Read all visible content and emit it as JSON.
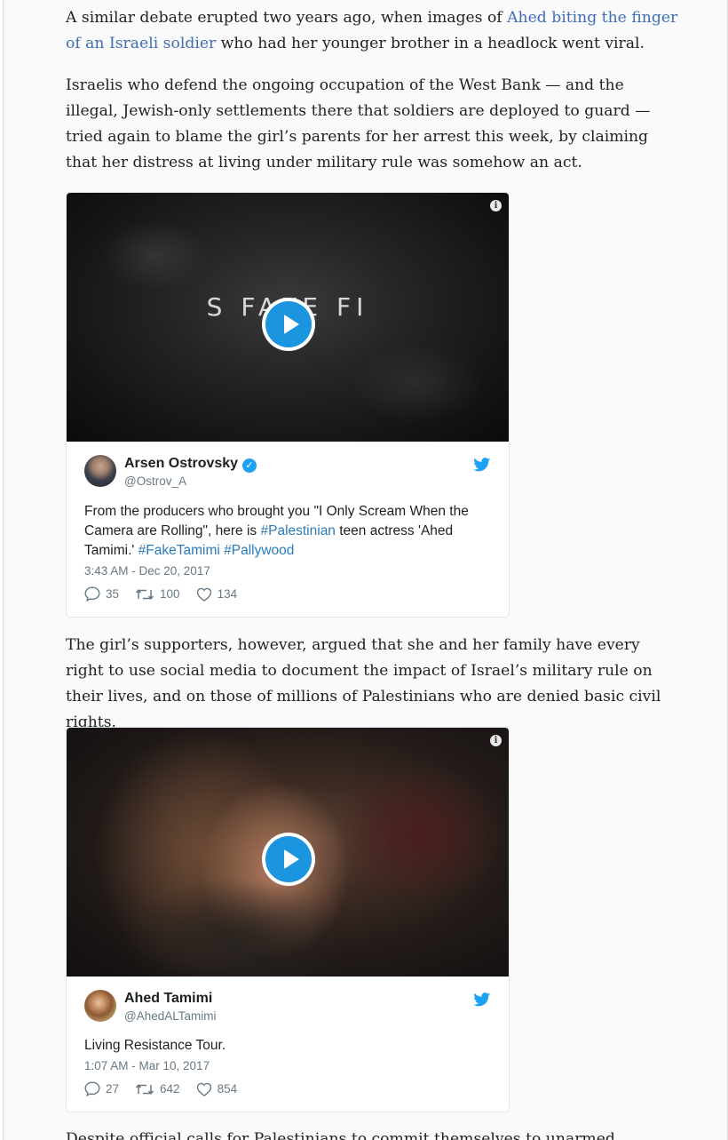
{
  "article": {
    "p1": {
      "before": "A similar debate erupted two years ago, when images of ",
      "link": "Ahed biting the finger of an Israeli soldier",
      "after": " who had her younger brother in a headlock went viral."
    },
    "p2": "Israelis who defend the ongoing occupation of the West Bank — and the illegal, Jewish-only settlements there that soldiers are deployed to guard — tried again to blame the girl’s parents for her arrest this week, by claiming that her distress at living under military rule was somehow an act.",
    "p3": "The girl’s supporters, however, argued that she and her family have every right to use social media to document the impact of Israel’s military rule on their lives, and on those of millions of Palestinians who are denied basic civil rights.",
    "p4": "Despite official calls for Palestinians to commit themselves to unarmed struggle"
  },
  "tweet1": {
    "video_overlay": "S FAKE FI",
    "name": "Arsen Ostrovsky",
    "verified_mark": "✓",
    "handle": "@Ostrov_A",
    "text_before": "From the producers who brought you \"I Only Scream When the Camera are Rolling\", here is ",
    "tag1": "#Palestinian",
    "text_mid": " teen actress 'Ahed Tamimi.' ",
    "tag2": "#FakeTamimi",
    "text_space": " ",
    "tag3": "#Pallywood",
    "time": "3:43 AM - Dec 20, 2017",
    "replies": "35",
    "retweets": "100",
    "likes": "134"
  },
  "tweet2": {
    "name": "Ahed Tamimi",
    "handle": "@AhedALTamimi",
    "text": "Living Resistance Tour.",
    "time": "1:07 AM - Mar 10, 2017",
    "replies": "27",
    "retweets": "642",
    "likes": "854"
  },
  "icons": {
    "info": "i"
  },
  "colors": {
    "link": "#3f6eb5",
    "play_button": "#1b95e0",
    "hashtag": "#2b7bb9",
    "twitter_blue": "#1da1f2"
  }
}
